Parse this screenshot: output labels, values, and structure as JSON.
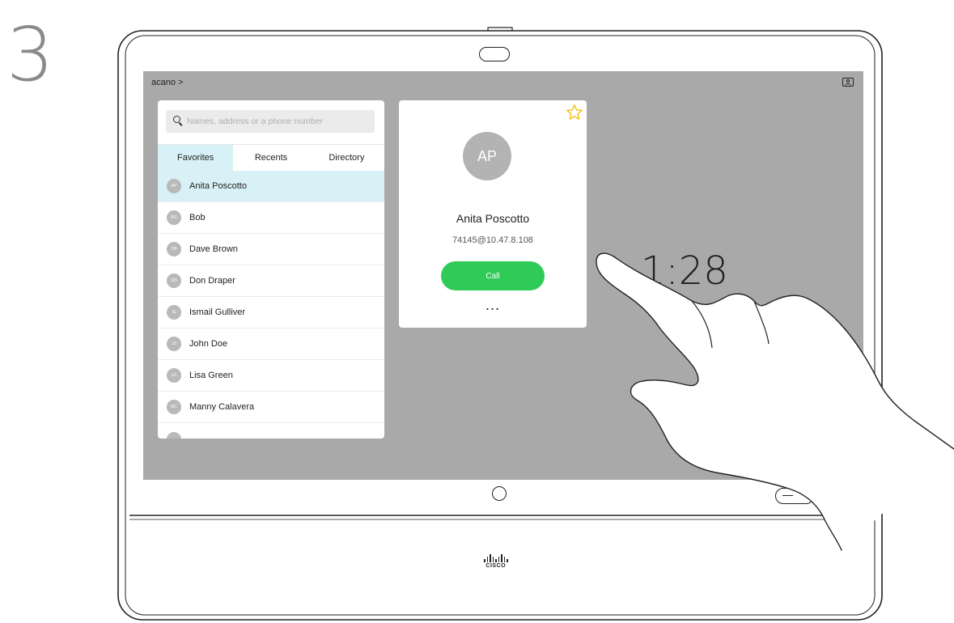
{
  "step": {
    "number": "3"
  },
  "screen": {
    "breadcrumb": "acano >",
    "search": {
      "placeholder": "Names, address or a phone number",
      "value": ""
    },
    "tabs": [
      {
        "label": "Favorites",
        "active": true
      },
      {
        "label": "Recents",
        "active": false
      },
      {
        "label": "Directory",
        "active": false
      }
    ],
    "contacts": [
      {
        "initials": "AP",
        "name": "Anita Poscotto",
        "selected": true
      },
      {
        "initials": "BO",
        "name": "Bob",
        "selected": false
      },
      {
        "initials": "DB",
        "name": "Dave Brown",
        "selected": false
      },
      {
        "initials": "DD",
        "name": "Don Draper",
        "selected": false
      },
      {
        "initials": "IG",
        "name": "Ismail Gulliver",
        "selected": false
      },
      {
        "initials": "JD",
        "name": "John Doe",
        "selected": false
      },
      {
        "initials": "LG",
        "name": "Lisa Green",
        "selected": false
      },
      {
        "initials": "MC",
        "name": "Manny Calavera",
        "selected": false
      }
    ],
    "card": {
      "initials": "AP",
      "name": "Anita Poscotto",
      "address": "74145@10.47.8.108",
      "call_label": "Call",
      "more_label": "...",
      "favorite": true
    },
    "clock": "1:28"
  },
  "device": {
    "logo_text": "CISCO"
  },
  "colors": {
    "screen_bg": "#a9a9a9",
    "selected_row": "#d8f1f6",
    "call_green": "#2ecc57",
    "star_yellow": "#f2b705"
  },
  "icons": [
    "search-icon",
    "self-view-icon",
    "star-icon",
    "home-button-icon",
    "camera-icon",
    "cisco-logo"
  ]
}
